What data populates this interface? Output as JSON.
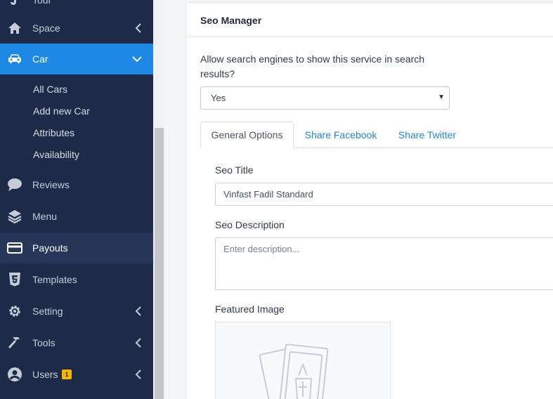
{
  "sidebar": {
    "items": [
      {
        "label": "Tour",
        "icon": "tour-icon"
      },
      {
        "label": "Space",
        "icon": "home-icon"
      },
      {
        "label": "Car",
        "icon": "car-icon"
      },
      {
        "label": "Reviews",
        "icon": "comment-icon"
      },
      {
        "label": "Menu",
        "icon": "layers-icon"
      },
      {
        "label": "Payouts",
        "icon": "credit-card-icon"
      },
      {
        "label": "Templates",
        "icon": "html5-icon"
      },
      {
        "label": "Setting",
        "icon": "gear-icon"
      },
      {
        "label": "Tools",
        "icon": "hammer-icon"
      },
      {
        "label": "Users",
        "icon": "users-icon"
      }
    ],
    "car_submenu": [
      "All Cars",
      "Add new Car",
      "Attributes",
      "Availability"
    ],
    "users_badge": "1"
  },
  "seo": {
    "title": "Seo Manager",
    "allow_label": "Allow search engines to show this service in search results?",
    "allow_value": "Yes",
    "tabs": [
      "General Options",
      "Share Facebook",
      "Share Twitter"
    ],
    "seo_title_label": "Seo Title",
    "seo_title_value": "Vinfast Fadil Standard",
    "seo_desc_label": "Seo Description",
    "seo_desc_placeholder": "Enter description...",
    "featured_image_label": "Featured Image"
  },
  "colors": {
    "sidebar_bg": "#1d2b48",
    "active_blue": "#1e88e5",
    "badge_yellow": "#f5b800"
  }
}
